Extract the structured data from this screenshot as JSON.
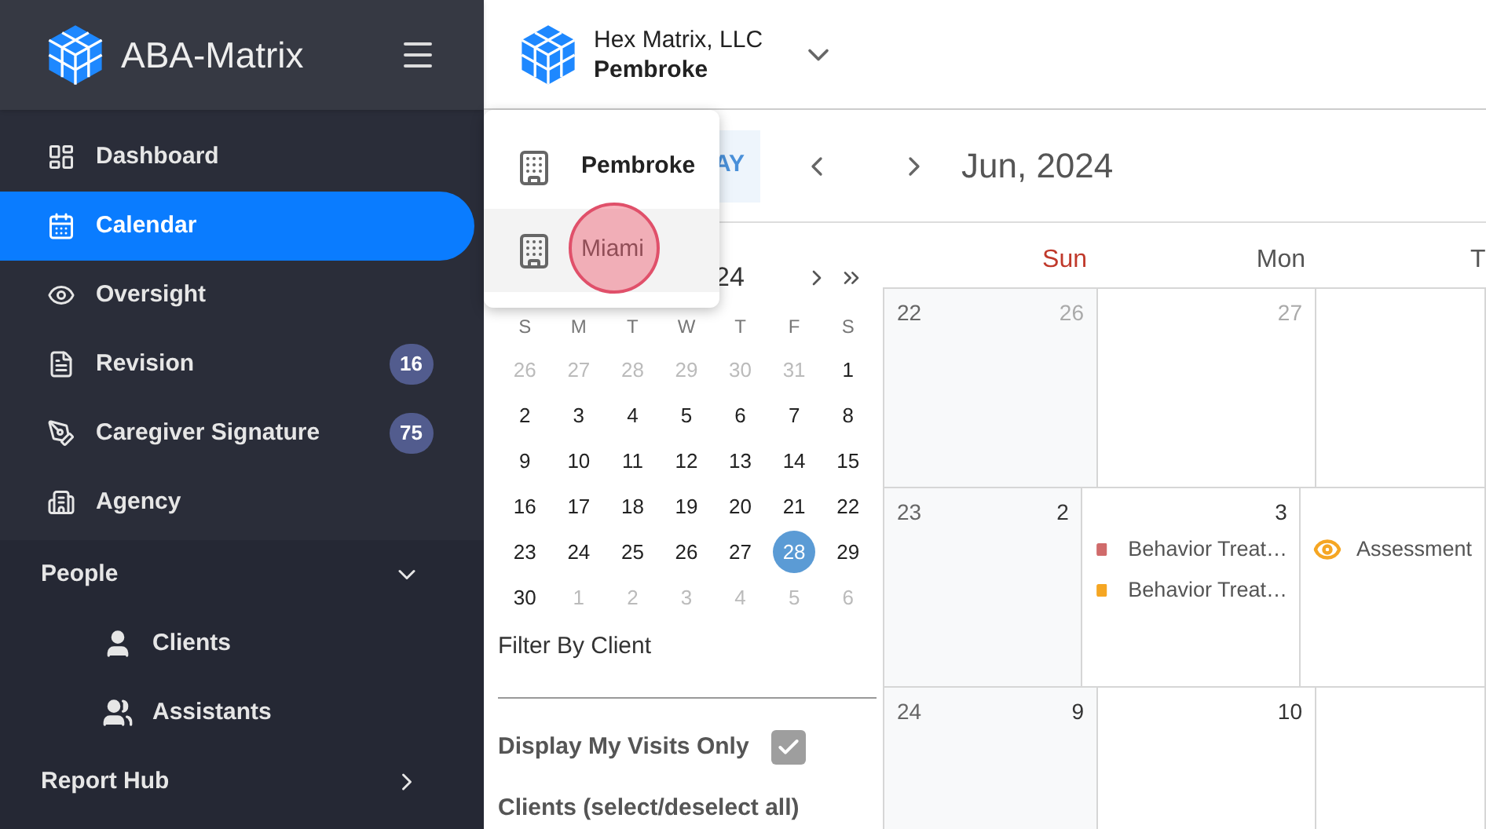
{
  "app": {
    "name": "ABA-Matrix"
  },
  "sidebar": {
    "items": [
      {
        "label": "Dashboard",
        "selected": false
      },
      {
        "label": "Calendar",
        "selected": true
      },
      {
        "label": "Oversight",
        "selected": false
      },
      {
        "label": "Revision",
        "selected": false,
        "badge": "16"
      },
      {
        "label": "Caregiver Signature",
        "selected": false,
        "badge": "75"
      },
      {
        "label": "Agency",
        "selected": false
      }
    ],
    "groups": [
      {
        "label": "People",
        "expanded": true,
        "children": [
          {
            "label": "Clients"
          },
          {
            "label": "Assistants"
          }
        ]
      },
      {
        "label": "Report Hub",
        "expanded": false
      }
    ]
  },
  "org_switcher": {
    "company": "Hex Matrix, LLC",
    "location": "Pembroke"
  },
  "location_menu": [
    {
      "label": "Pembroke",
      "selected": true,
      "hovered": false,
      "clicked": false
    },
    {
      "label": "Miami",
      "selected": false,
      "hovered": true,
      "clicked": true
    }
  ],
  "toolbar": {
    "today_button": "AY",
    "title": "Jun, 2024"
  },
  "mini_calendar": {
    "title": "24",
    "weekdays": [
      "S",
      "M",
      "T",
      "W",
      "T",
      "F",
      "S"
    ],
    "weeks": [
      [
        {
          "day": "26",
          "muted": true,
          "selected": false
        },
        {
          "day": "27",
          "muted": true,
          "selected": false
        },
        {
          "day": "28",
          "muted": true,
          "selected": false
        },
        {
          "day": "29",
          "muted": true,
          "selected": false
        },
        {
          "day": "30",
          "muted": true,
          "selected": false
        },
        {
          "day": "31",
          "muted": true,
          "selected": false
        },
        {
          "day": "1",
          "muted": false,
          "selected": false
        }
      ],
      [
        {
          "day": "2",
          "muted": false,
          "selected": false
        },
        {
          "day": "3",
          "muted": false,
          "selected": false
        },
        {
          "day": "4",
          "muted": false,
          "selected": false
        },
        {
          "day": "5",
          "muted": false,
          "selected": false
        },
        {
          "day": "6",
          "muted": false,
          "selected": false
        },
        {
          "day": "7",
          "muted": false,
          "selected": false
        },
        {
          "day": "8",
          "muted": false,
          "selected": false
        }
      ],
      [
        {
          "day": "9",
          "muted": false,
          "selected": false
        },
        {
          "day": "10",
          "muted": false,
          "selected": false
        },
        {
          "day": "11",
          "muted": false,
          "selected": false
        },
        {
          "day": "12",
          "muted": false,
          "selected": false
        },
        {
          "day": "13",
          "muted": false,
          "selected": false
        },
        {
          "day": "14",
          "muted": false,
          "selected": false
        },
        {
          "day": "15",
          "muted": false,
          "selected": false
        }
      ],
      [
        {
          "day": "16",
          "muted": false,
          "selected": false
        },
        {
          "day": "17",
          "muted": false,
          "selected": false
        },
        {
          "day": "18",
          "muted": false,
          "selected": false
        },
        {
          "day": "19",
          "muted": false,
          "selected": false
        },
        {
          "day": "20",
          "muted": false,
          "selected": false
        },
        {
          "day": "21",
          "muted": false,
          "selected": false
        },
        {
          "day": "22",
          "muted": false,
          "selected": false
        }
      ],
      [
        {
          "day": "23",
          "muted": false,
          "selected": false
        },
        {
          "day": "24",
          "muted": false,
          "selected": false
        },
        {
          "day": "25",
          "muted": false,
          "selected": false
        },
        {
          "day": "26",
          "muted": false,
          "selected": false
        },
        {
          "day": "27",
          "muted": false,
          "selected": false
        },
        {
          "day": "28",
          "muted": false,
          "selected": true
        },
        {
          "day": "29",
          "muted": false,
          "selected": false
        }
      ],
      [
        {
          "day": "30",
          "muted": false,
          "selected": false
        },
        {
          "day": "1",
          "muted": true,
          "selected": false
        },
        {
          "day": "2",
          "muted": true,
          "selected": false
        },
        {
          "day": "3",
          "muted": true,
          "selected": false
        },
        {
          "day": "4",
          "muted": true,
          "selected": false
        },
        {
          "day": "5",
          "muted": true,
          "selected": false
        },
        {
          "day": "6",
          "muted": true,
          "selected": false
        }
      ]
    ]
  },
  "filter": {
    "label": "Filter By Client",
    "my_visits_label": "Display My Visits Only",
    "my_visits_checked": true,
    "clients_label": "Clients (select/deselect all)"
  },
  "month_view": {
    "columns": [
      "Sun",
      "Mon",
      "T"
    ],
    "weeks": [
      {
        "week": "22",
        "days": [
          {
            "date": "26",
            "muted": true
          },
          {
            "date": "27",
            "muted": true
          }
        ]
      },
      {
        "week": "23",
        "days": [
          {
            "date": "2",
            "muted": false
          },
          {
            "date": "3",
            "muted": false,
            "events": [
              {
                "kind": "book",
                "title": "Behavior Treat…",
                "color": "#d06b6b"
              },
              {
                "kind": "book",
                "title": "Behavior Treat…",
                "color": "#f5a623"
              }
            ]
          },
          {
            "events": [
              {
                "kind": "eye",
                "title": "Assessment",
                "color": "#f5a623"
              }
            ]
          }
        ]
      },
      {
        "week": "24",
        "days": [
          {
            "date": "9",
            "muted": false
          },
          {
            "date": "10",
            "muted": false
          }
        ]
      }
    ]
  }
}
